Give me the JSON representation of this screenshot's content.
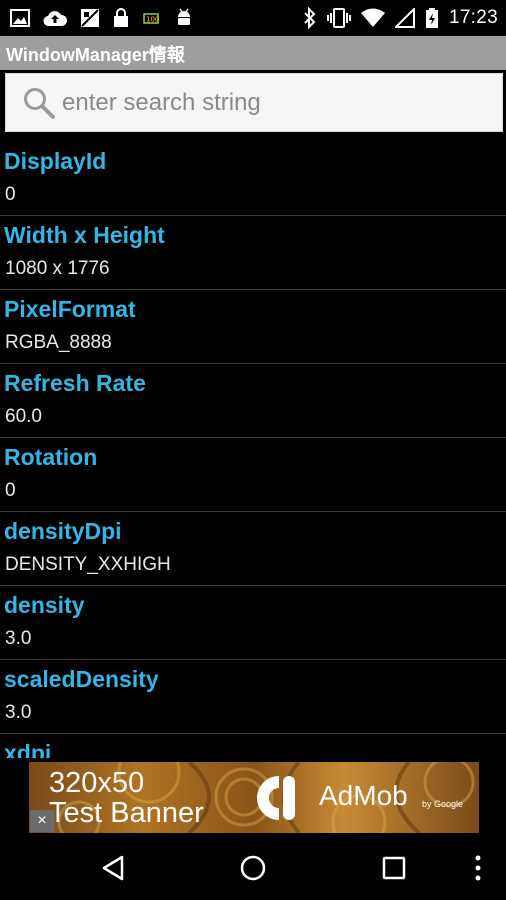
{
  "status_bar": {
    "time": "17:23",
    "left_icons": [
      "image-icon",
      "cloud-upload-icon",
      "gallery-icon",
      "lock-icon",
      "battery-saver-icon",
      "android-debug-icon"
    ],
    "right_icons": [
      "bluetooth-icon",
      "vibrate-icon",
      "wifi-icon",
      "signal-icon",
      "battery-charging-icon"
    ]
  },
  "app": {
    "title": "WindowManager情報",
    "title_bar_color": "#9e9e9e",
    "accent_color": "#33b5e5"
  },
  "search": {
    "placeholder": "enter search string",
    "value": ""
  },
  "items": [
    {
      "label": "DisplayId",
      "value": "0"
    },
    {
      "label": "Width x Height",
      "value": "1080 x 1776"
    },
    {
      "label": "PixelFormat",
      "value": "RGBA_8888"
    },
    {
      "label": "Refresh Rate",
      "value": "60.0"
    },
    {
      "label": "Rotation",
      "value": "0"
    },
    {
      "label": "densityDpi",
      "value": "DENSITY_XXHIGH"
    },
    {
      "label": "density",
      "value": "3.0"
    },
    {
      "label": "scaledDensity",
      "value": "3.0"
    },
    {
      "label": "xdpi",
      "value": ""
    }
  ],
  "ad": {
    "line1": "320x50",
    "line2": "Test Banner",
    "brand": "AdMob",
    "by": "by Google",
    "close": "×"
  },
  "nav": [
    "back-icon",
    "home-icon",
    "recents-icon",
    "overflow-menu-icon"
  ]
}
